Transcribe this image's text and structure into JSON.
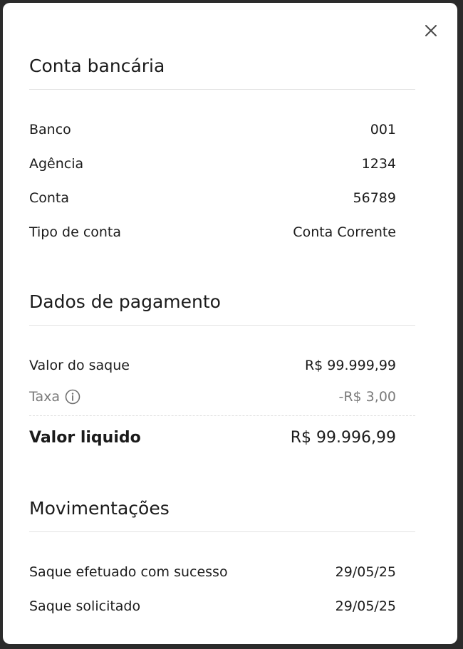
{
  "bank_account": {
    "title": "Conta bancária",
    "rows": [
      {
        "label": "Banco",
        "value": "001"
      },
      {
        "label": "Agência",
        "value": "1234"
      },
      {
        "label": "Conta",
        "value": "56789"
      },
      {
        "label": "Tipo de conta",
        "value": "Conta Corrente"
      }
    ]
  },
  "payment": {
    "title": "Dados de pagamento",
    "withdraw_label": "Valor do saque",
    "withdraw_value": "R$ 99.999,99",
    "fee_label": "Taxa",
    "fee_value": "-R$ 3,00",
    "net_label": "Valor liquido",
    "net_value": "R$ 99.996,99"
  },
  "movements": {
    "title": "Movimentações",
    "rows": [
      {
        "label": "Saque efetuado com sucesso",
        "value": "29/05/25"
      },
      {
        "label": "Saque solicitado",
        "value": "29/05/25"
      }
    ]
  },
  "icons": {
    "close": "close-icon",
    "info": "info-icon"
  },
  "colors": {
    "backdrop": "#2b2b2b",
    "surface": "#ffffff",
    "text": "#1b1b1b",
    "muted": "#7a7a7a",
    "divider": "#e3e3e3"
  }
}
